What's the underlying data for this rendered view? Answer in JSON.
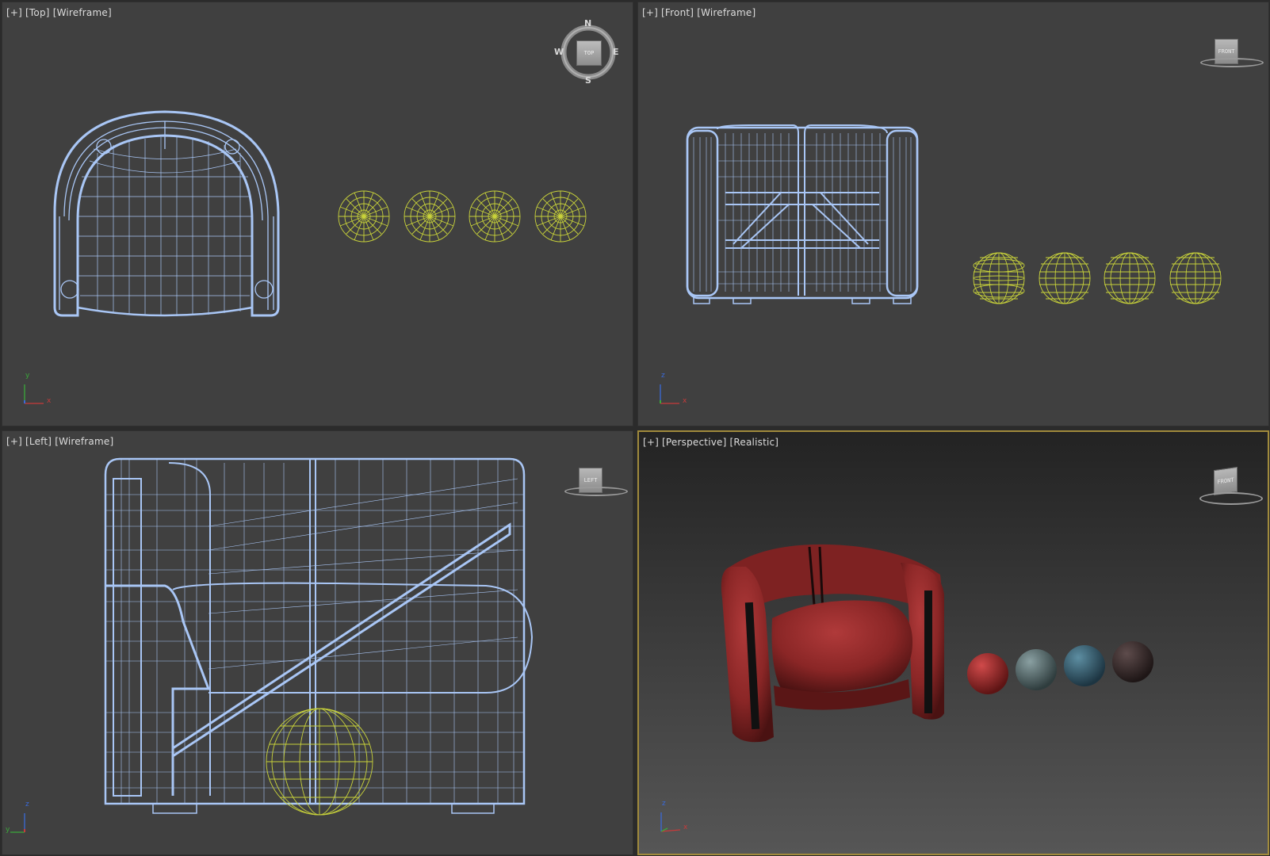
{
  "viewports": {
    "top": {
      "plus": "[+]",
      "view": "[Top]",
      "shading": "[Wireframe]",
      "cube": "TOP",
      "axes": {
        "v": "y",
        "h": "x"
      }
    },
    "front": {
      "plus": "[+]",
      "view": "[Front]",
      "shading": "[Wireframe]",
      "cube": "FRONT",
      "axes": {
        "v": "z",
        "h": "x"
      }
    },
    "left": {
      "plus": "[+]",
      "view": "[Left]",
      "shading": "[Wireframe]",
      "cube": "LEFT",
      "axes": {
        "v": "z",
        "h": "y"
      }
    },
    "persp": {
      "plus": "[+]",
      "view": "[Perspective]",
      "shading": "[Realistic]",
      "cube": "FRONT",
      "axes": {
        "v": "z",
        "h": "x"
      }
    }
  },
  "compass": {
    "n": "N",
    "s": "S",
    "e": "E",
    "w": "W"
  },
  "colors": {
    "wire": "#a9c6f5",
    "light": "#c8d23a",
    "chair": "#8e2a2a",
    "spheres": [
      "#9b2626",
      "#5f7677",
      "#3f6878",
      "#3d3131"
    ],
    "active_border": "#a08a3c"
  }
}
